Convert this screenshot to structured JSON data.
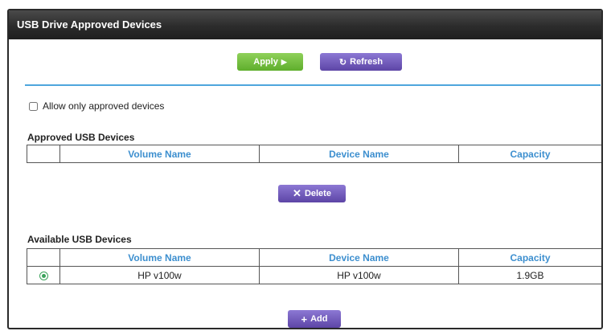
{
  "panel": {
    "title": "USB Drive Approved Devices"
  },
  "toolbar": {
    "apply_label": "Apply",
    "apply_icon": "arrow-right-icon",
    "refresh_label": "Refresh",
    "refresh_icon": "refresh-icon"
  },
  "options": {
    "allow_only_approved_label": "Allow only approved devices",
    "allow_only_approved_checked": false
  },
  "approved": {
    "title": "Approved USB Devices",
    "columns": [
      "Volume Name",
      "Device Name",
      "Capacity"
    ],
    "rows": [],
    "delete_label": "Delete",
    "delete_icon": "x-icon"
  },
  "available": {
    "title": "Available USB Devices",
    "columns": [
      "Volume Name",
      "Device Name",
      "Capacity"
    ],
    "rows": [
      {
        "volume_name": "HP v100w",
        "device_name": "HP v100w",
        "capacity": "1.9GB",
        "selected": true
      }
    ],
    "add_label": "Add",
    "add_icon": "plus-icon"
  },
  "colors": {
    "accent_green": "#6cbf3a",
    "accent_purple": "#6d56b8",
    "header_blue": "#3d8fcf",
    "divider_blue": "#4ea6dd"
  }
}
